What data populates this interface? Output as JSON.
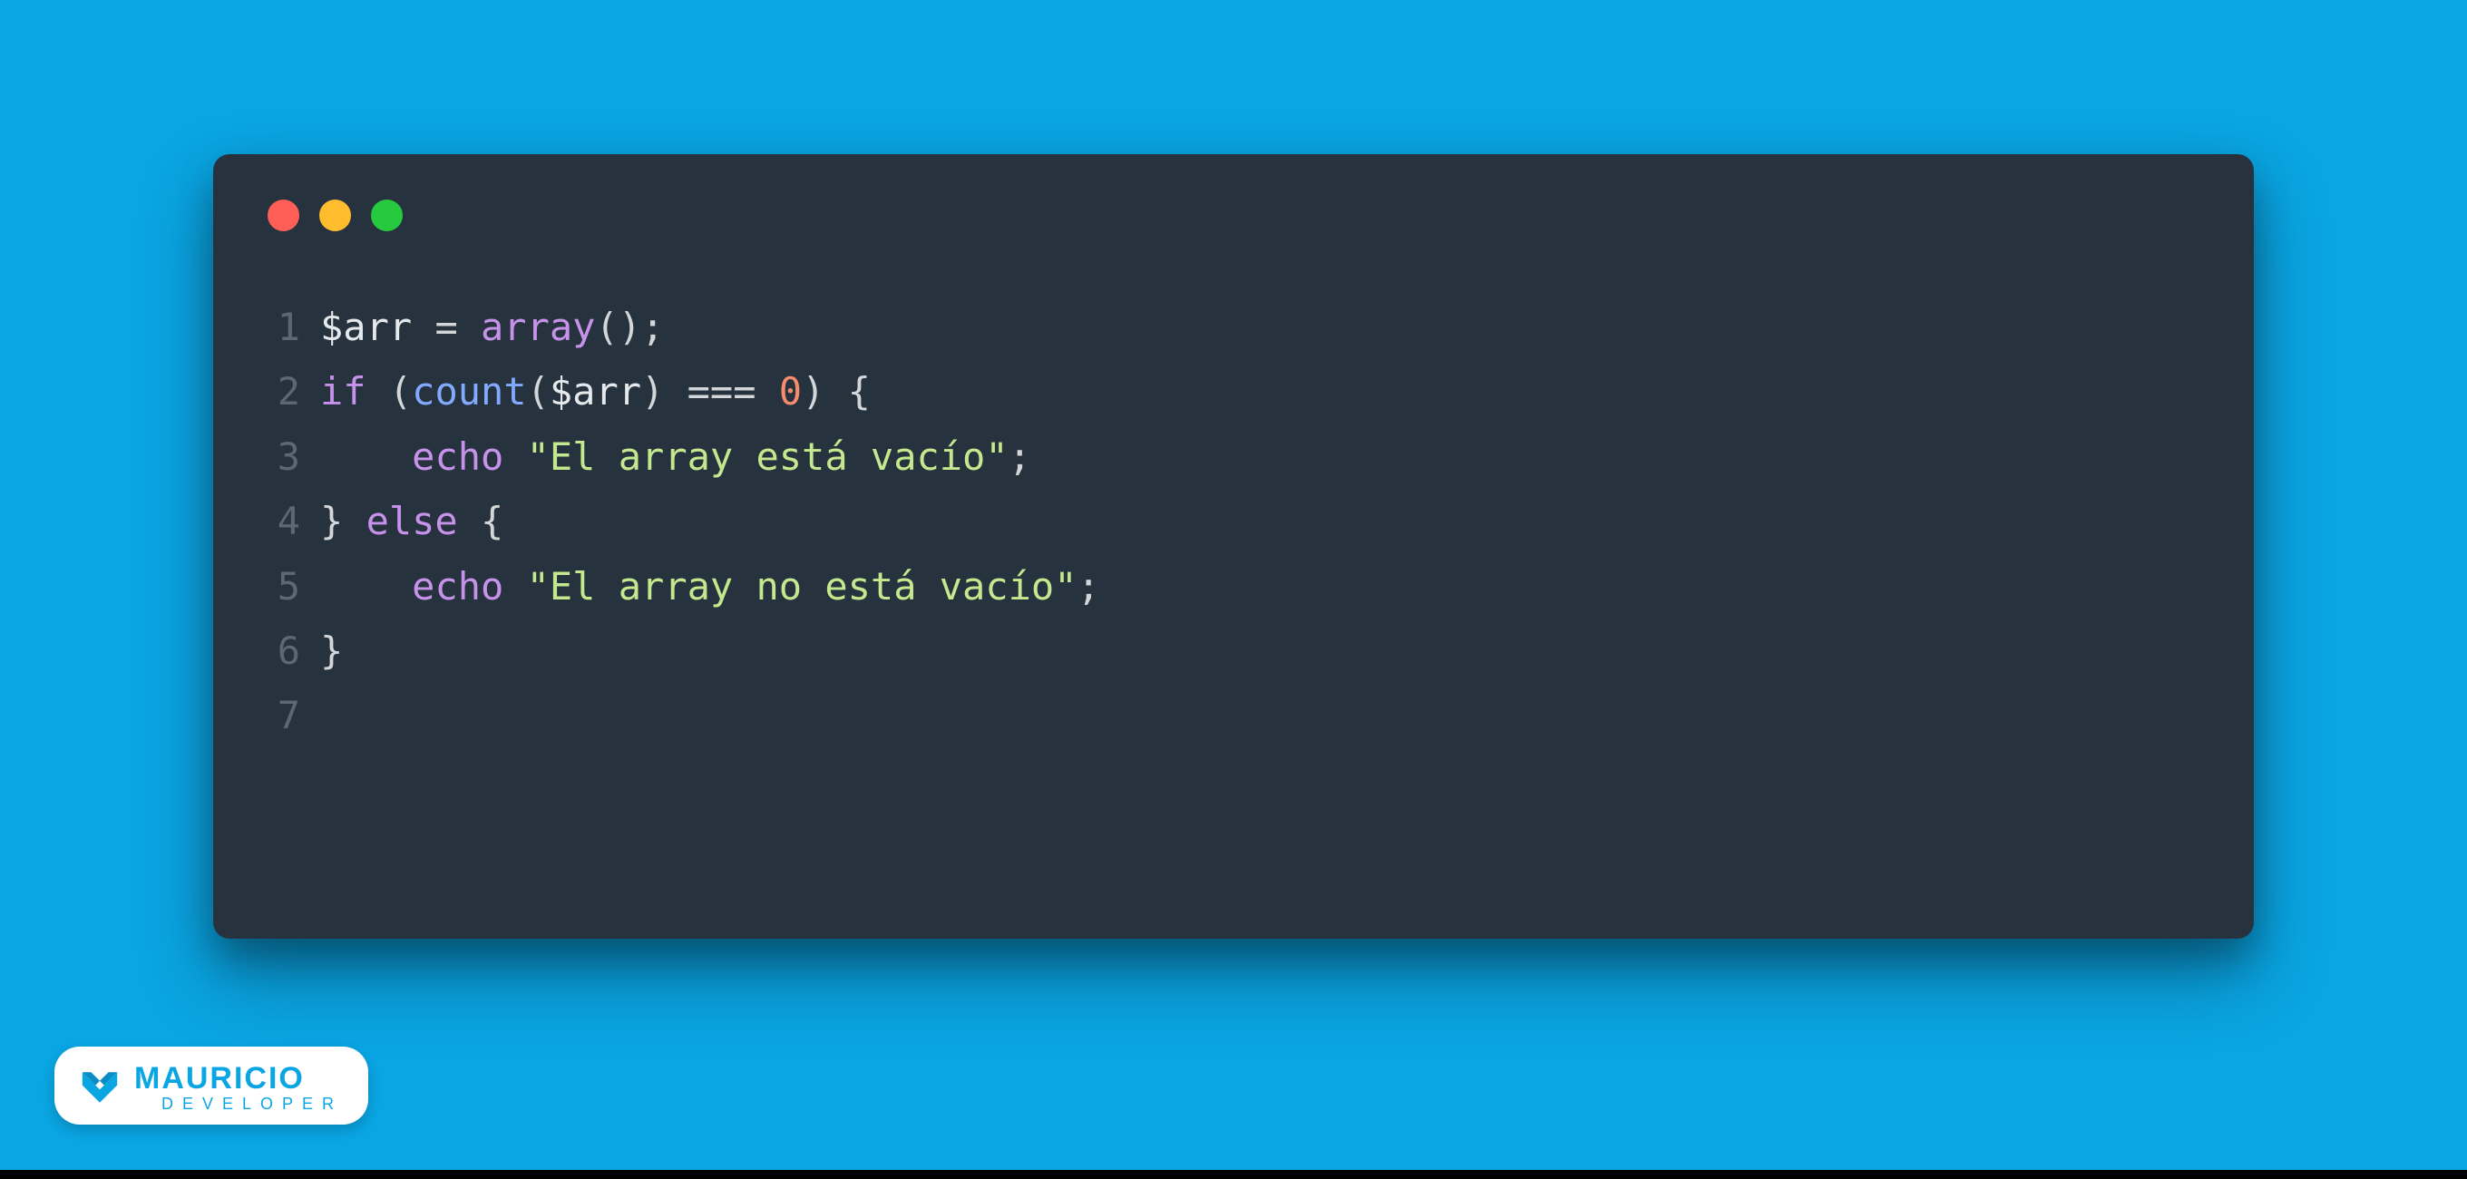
{
  "window": {
    "traffic_light_colors": {
      "red": "#ff5f56",
      "yellow": "#ffbd2e",
      "green": "#27c93f"
    }
  },
  "code": {
    "lines": [
      {
        "n": "1",
        "tokens": [
          {
            "c": "t-var",
            "t": "$arr"
          },
          {
            "c": "t-op",
            "t": " = "
          },
          {
            "c": "t-keyword",
            "t": "array"
          },
          {
            "c": "t-paren",
            "t": "();"
          }
        ]
      },
      {
        "n": "2",
        "tokens": [
          {
            "c": "t-keyword",
            "t": "if"
          },
          {
            "c": "t-paren",
            "t": " ("
          },
          {
            "c": "t-func",
            "t": "count"
          },
          {
            "c": "t-paren",
            "t": "("
          },
          {
            "c": "t-var",
            "t": "$arr"
          },
          {
            "c": "t-paren",
            "t": ") "
          },
          {
            "c": "t-op",
            "t": "=== "
          },
          {
            "c": "t-num",
            "t": "0"
          },
          {
            "c": "t-paren",
            "t": ") "
          },
          {
            "c": "t-brace",
            "t": "{"
          }
        ]
      },
      {
        "n": "3",
        "tokens": [
          {
            "c": "",
            "t": "    "
          },
          {
            "c": "t-echo",
            "t": "echo"
          },
          {
            "c": "",
            "t": " "
          },
          {
            "c": "t-string",
            "t": "\"El array está vacío\""
          },
          {
            "c": "t-semi",
            "t": ";"
          }
        ]
      },
      {
        "n": "4",
        "tokens": [
          {
            "c": "t-brace",
            "t": "} "
          },
          {
            "c": "t-keyword",
            "t": "else"
          },
          {
            "c": "t-brace",
            "t": " {"
          }
        ]
      },
      {
        "n": "5",
        "tokens": [
          {
            "c": "",
            "t": "    "
          },
          {
            "c": "t-echo",
            "t": "echo"
          },
          {
            "c": "",
            "t": " "
          },
          {
            "c": "t-string",
            "t": "\"El array no está vacío\""
          },
          {
            "c": "t-semi",
            "t": ";"
          }
        ]
      },
      {
        "n": "6",
        "tokens": [
          {
            "c": "t-brace",
            "t": "}"
          }
        ]
      },
      {
        "n": "7",
        "tokens": []
      }
    ]
  },
  "brand": {
    "title": "MAURICIO",
    "subtitle": "DEVELOPER"
  }
}
